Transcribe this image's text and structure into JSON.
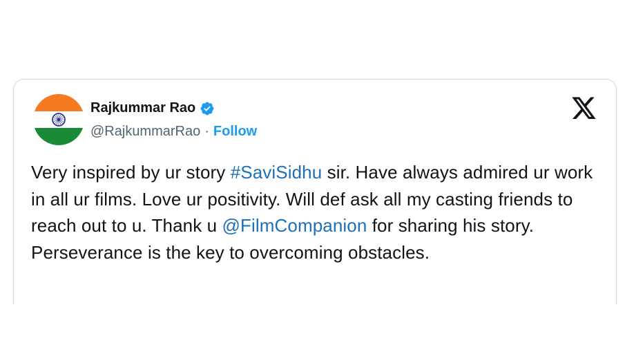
{
  "tweet": {
    "author": {
      "display_name": "Rajkummar Rao",
      "handle": "@RajkummarRao",
      "separator": "·",
      "follow_label": "Follow",
      "verified": true
    },
    "text_parts": {
      "part1": "Very inspired by ur story ",
      "hashtag": "#SaviSidhu",
      "part2": " sir. Have always admired ur work in all ur films. Love ur positivity. Will def ask all my casting friends to reach out to u. Thank u ",
      "mention": "@FilmCompanion",
      "part3": " for sharing his story. Perseverance is the key to overcoming obstacles."
    }
  },
  "colors": {
    "link": "#1d6fb8",
    "follow": "#1d9bf0",
    "verified": "#1d9bf0",
    "flag_saffron": "#f47b20",
    "flag_green": "#1a8a36",
    "chakra": "#1a2a8a"
  },
  "icons": {
    "verified": "verified-badge-icon",
    "brand": "x-logo-icon",
    "avatar": "india-flag-avatar"
  }
}
